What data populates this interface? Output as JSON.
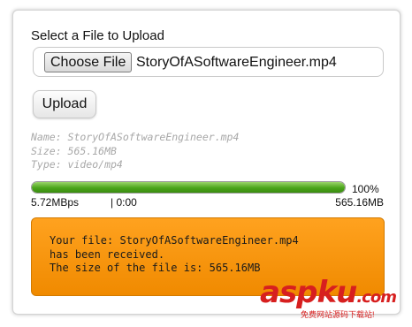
{
  "heading": "Select a File to Upload",
  "file_input": {
    "button_label": "Choose File",
    "selected_file": "StoryOfASoftwareEngineer.mp4"
  },
  "upload_button_label": "Upload",
  "file_info": {
    "name": "Name: StoryOfASoftwareEngineer.mp4",
    "size": "Size: 565.16MB",
    "type": "Type: video/mp4"
  },
  "progress": {
    "percent_label": "100%",
    "percent": 100,
    "speed": "5.72MBps",
    "time": "| 0:00",
    "total_size": "565.16MB"
  },
  "result": {
    "line1": "Your file: StoryOfASoftwareEngineer.mp4",
    "line2": "has been received.",
    "line3": "The size of the file is: 565.16MB"
  },
  "watermark": {
    "logo": "aspku",
    "suffix": ".com",
    "tagline": "免费网站源码下载站!"
  },
  "colors": {
    "progress_green": "#4aa51b",
    "notice_orange": "#f59300",
    "watermark_red": "#d71f1f"
  }
}
